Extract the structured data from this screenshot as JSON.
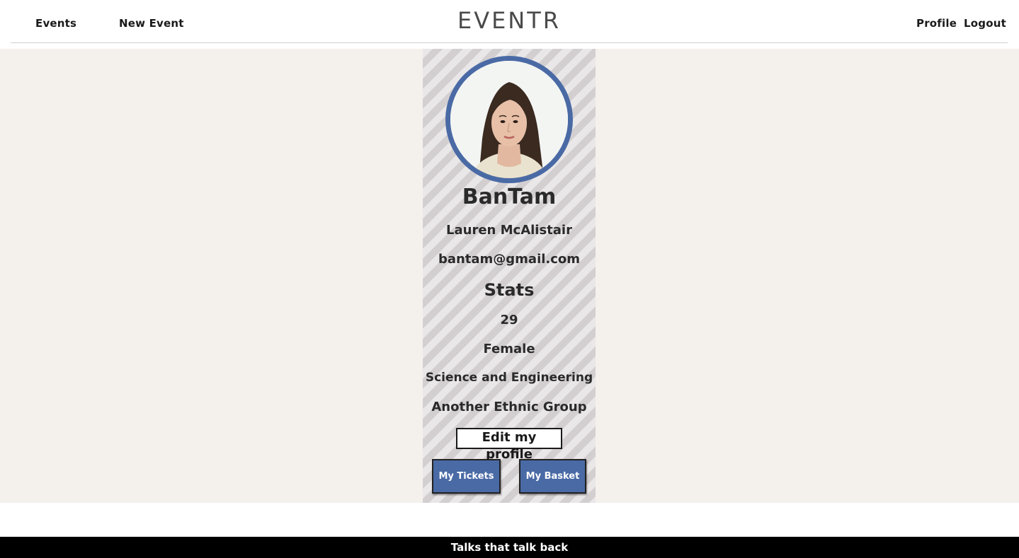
{
  "nav": {
    "events": "Events",
    "new_event": "New Event",
    "brand": "EVENTR",
    "profile": "Profile",
    "logout": "Logout"
  },
  "profile": {
    "username": "BanTam",
    "full_name": "Lauren McAlistair",
    "email": "bantam@gmail.com",
    "stats_title": "Stats",
    "age": "29",
    "gender": "Female",
    "field": "Science and Engineering",
    "ethnicity": "Another Ethnic Group",
    "edit_label": "Edit my profile",
    "tickets_label": "My Tickets",
    "basket_label": "My Basket"
  },
  "footer": {
    "tagline": "Talks that talk back"
  },
  "colors": {
    "accent": "#4a6aa5",
    "page_bg": "#f4f0ec",
    "footer_bg": "#000000"
  }
}
